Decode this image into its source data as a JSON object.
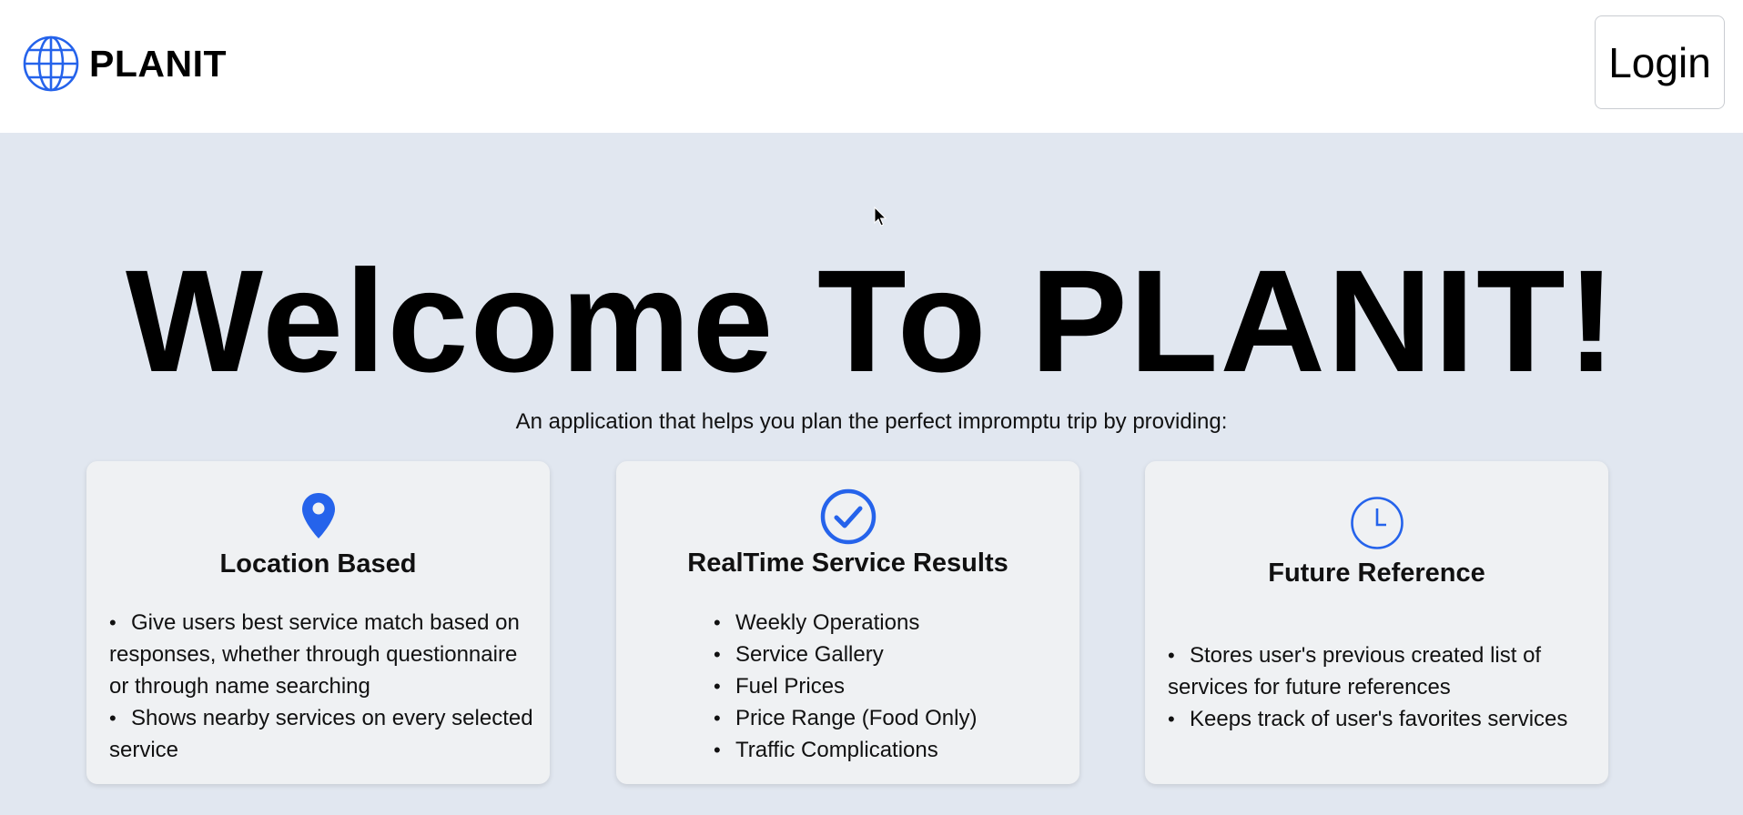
{
  "header": {
    "brand": "PLANIT",
    "logo_icon": "globe-icon",
    "login_label": "Login"
  },
  "hero": {
    "title": "Welcome To PLANIT!",
    "subtitle": "An application that helps you plan the perfect impromptu trip by providing:"
  },
  "features": [
    {
      "icon": "map-pin-icon",
      "title": "Location Based",
      "items": [
        "Give users best service match based on responses, whether through questionnaire or through name searching",
        "Shows nearby services on every selected service"
      ]
    },
    {
      "icon": "check-circle-icon",
      "title": "RealTime Service Results",
      "items": [
        "Weekly Operations",
        "Service Gallery",
        "Fuel Prices",
        "Price Range (Food Only)",
        "Traffic Complications"
      ]
    },
    {
      "icon": "clock-icon",
      "title": "Future Reference",
      "items": [
        "Stores user's previous created list of services for future references",
        "Keeps track of user's favorites services"
      ]
    }
  ],
  "colors": {
    "accent": "#2563eb",
    "background": "#e1e7f0",
    "card": "#eff1f3",
    "header": "#ffffff"
  }
}
